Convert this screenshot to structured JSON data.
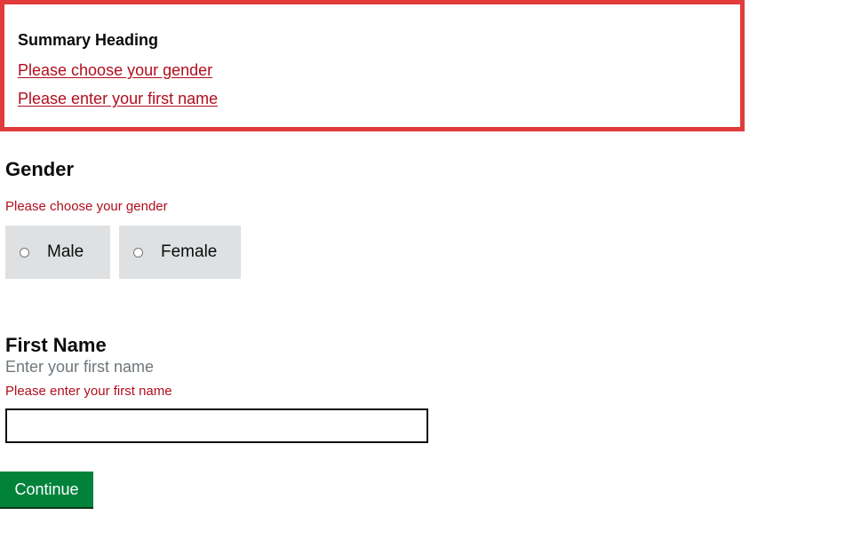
{
  "error_summary": {
    "heading": "Summary Heading",
    "links": [
      {
        "label": "Please choose your gender"
      },
      {
        "label": "Please enter your first name"
      }
    ],
    "border_color": "#e23b3b",
    "link_color": "#b10e1e"
  },
  "gender": {
    "legend": "Gender",
    "error": "Please choose your gender",
    "options": [
      {
        "label": "Male",
        "selected": false
      },
      {
        "label": "Female",
        "selected": false
      }
    ]
  },
  "first_name": {
    "label": "First Name",
    "hint": "Enter your first name",
    "error": "Please enter your first name",
    "value": ""
  },
  "continue_button": {
    "label": "Continue",
    "color": "#00823b"
  }
}
